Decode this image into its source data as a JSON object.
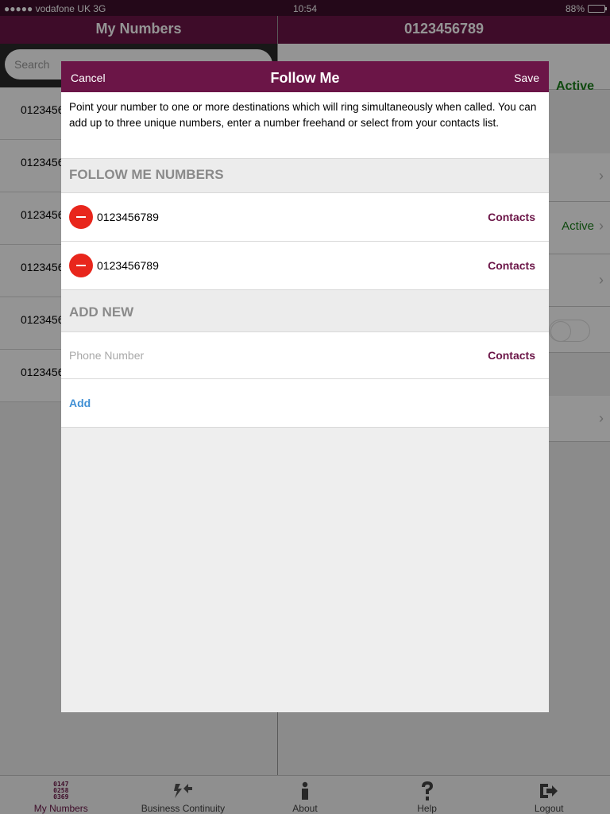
{
  "status_bar": {
    "carrier": "●●●●● vodafone UK  3G",
    "time": "10:54",
    "battery": "88%",
    "battery_level": 0.88
  },
  "master": {
    "title": "My Numbers",
    "search_placeholder": "Search",
    "rows": [
      "0123456",
      "0123456",
      "0123456",
      "0123456",
      "0123456",
      "0123456"
    ]
  },
  "detail": {
    "title": "0123456789",
    "status_top": "Active",
    "status_mid": "Active"
  },
  "modal": {
    "cancel_label": "Cancel",
    "title": "Follow Me",
    "save_label": "Save",
    "intro": "Point your number to one or more destinations which will ring simultaneously when called. You can add up to three unique numbers, enter a number freehand or select from your contacts list.",
    "follow_me_header": "FOLLOW ME NUMBERS",
    "numbers": [
      {
        "value": "0123456789",
        "contacts_label": "Contacts"
      },
      {
        "value": "0123456789",
        "contacts_label": "Contacts"
      }
    ],
    "add_new_header": "ADD NEW",
    "phone_placeholder": "Phone Number",
    "phone_value": "",
    "input_contacts_label": "Contacts",
    "add_label": "Add"
  },
  "tabs": [
    {
      "label": "My  Numbers",
      "icon": "numbers-icon",
      "icon_text": "0147\n0258\n0369",
      "selected": true
    },
    {
      "label": "Business  Continuity",
      "icon": "business-continuity-icon"
    },
    {
      "label": "About",
      "icon": "info-icon"
    },
    {
      "label": "Help",
      "icon": "help-icon"
    },
    {
      "label": "Logout",
      "icon": "logout-icon"
    }
  ],
  "colors": {
    "brand": "#6b1547",
    "status_bar": "#3e0f2c",
    "remove": "#e8261c",
    "active": "#1a7f1a",
    "link": "#3f8fd4"
  }
}
